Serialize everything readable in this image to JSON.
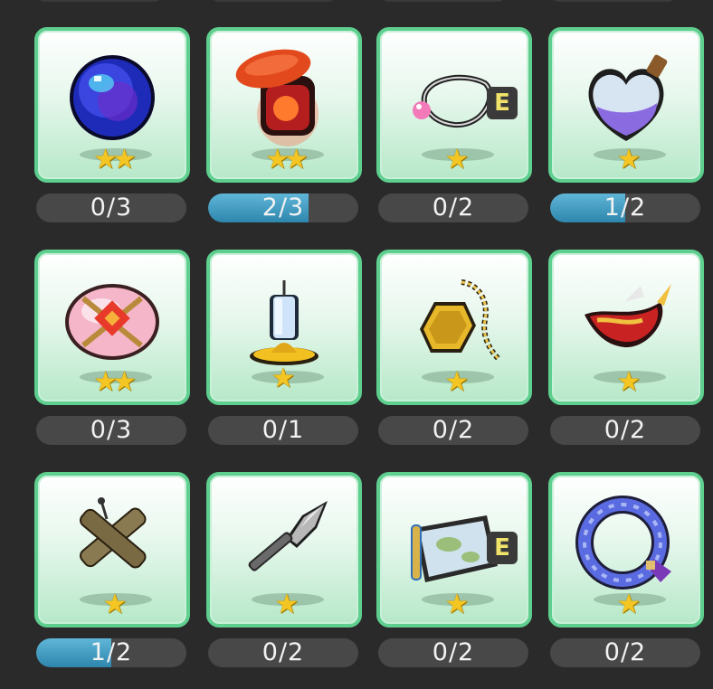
{
  "collection": {
    "items": [
      {
        "icon": "blue-orb-icon",
        "stars": "★★",
        "count": "0/3",
        "progress": 0.0,
        "badge": ""
      },
      {
        "icon": "red-jar-icon",
        "stars": "★★",
        "count": "2/3",
        "progress": 0.67,
        "badge": ""
      },
      {
        "icon": "pearl-necklace-icon",
        "stars": "★",
        "count": "0/2",
        "progress": 0.0,
        "badge": "E"
      },
      {
        "icon": "heart-potion-icon",
        "stars": "★",
        "count": "1/2",
        "progress": 0.5,
        "badge": ""
      },
      {
        "icon": "pink-cushion-icon",
        "stars": "★★",
        "count": "0/3",
        "progress": 0.0,
        "badge": ""
      },
      {
        "icon": "candle-icon",
        "stars": "★",
        "count": "0/1",
        "progress": 0.0,
        "badge": ""
      },
      {
        "icon": "gold-pendant-icon",
        "stars": "★",
        "count": "0/2",
        "progress": 0.0,
        "badge": ""
      },
      {
        "icon": "red-horn-icon",
        "stars": "★",
        "count": "0/2",
        "progress": 0.0,
        "badge": ""
      },
      {
        "icon": "voodoo-doll-icon",
        "stars": "★",
        "count": "1/2",
        "progress": 0.5,
        "badge": ""
      },
      {
        "icon": "spear-head-icon",
        "stars": "★",
        "count": "0/2",
        "progress": 0.0,
        "badge": ""
      },
      {
        "icon": "treasure-map-icon",
        "stars": "★",
        "count": "0/2",
        "progress": 0.0,
        "badge": "E"
      },
      {
        "icon": "blue-ring-icon",
        "stars": "★",
        "count": "0/2",
        "progress": 0.0,
        "badge": ""
      }
    ]
  },
  "colors": {
    "card_border": "#5ecf8e",
    "star": "#f3c623",
    "progress_fill": "#3a97c0",
    "bar_bg": "#484848",
    "background": "#2a2a2a"
  }
}
